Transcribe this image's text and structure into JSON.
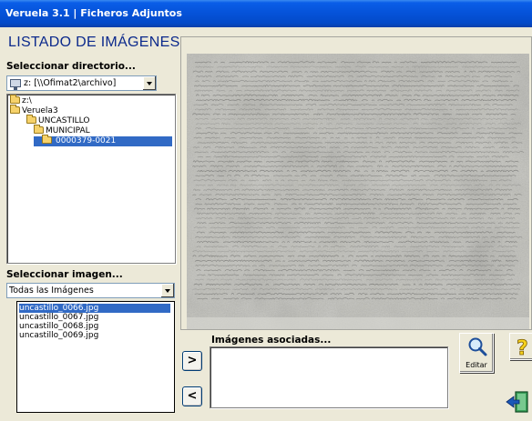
{
  "window": {
    "title": "Veruela 3.1  |  Ficheros Adjuntos"
  },
  "page_title": "LISTADO DE IMÁGENES",
  "directory": {
    "label": "Seleccionar directorio...",
    "drive_select": "z: [\\\\Ofimat2\\archivo]",
    "drive_icon": "network-drive-icon",
    "tree": [
      {
        "label": "z:\\",
        "level": 0,
        "selected": false
      },
      {
        "label": "Veruela3",
        "level": 0,
        "selected": false
      },
      {
        "label": "UNCASTILLO",
        "level": 1,
        "selected": false
      },
      {
        "label": "MUNICIPAL",
        "level": 2,
        "selected": false
      },
      {
        "label": "0000379-0021",
        "level": 3,
        "selected": true
      }
    ]
  },
  "image_select": {
    "label": "Seleccionar imagen...",
    "filter": "Todas las Imágenes",
    "files": [
      {
        "name": "uncastillo_0066.jpg",
        "selected": true
      },
      {
        "name": "uncastillo_0067.jpg",
        "selected": false
      },
      {
        "name": "uncastillo_0068.jpg",
        "selected": false
      },
      {
        "name": "uncastillo_0069.jpg",
        "selected": false
      }
    ]
  },
  "associated": {
    "label": "Imágenes asociadas...",
    "add_label": ">",
    "remove_label": "<"
  },
  "tools": {
    "edit_label": "Editar",
    "help_icon": "question-mark-icon",
    "exit_icon": "exit-door-icon",
    "search_icon": "magnifier-icon"
  },
  "colors": {
    "titlebar": "#0552d8",
    "selection": "#316ac5",
    "page_title": "#0c2a8c"
  }
}
